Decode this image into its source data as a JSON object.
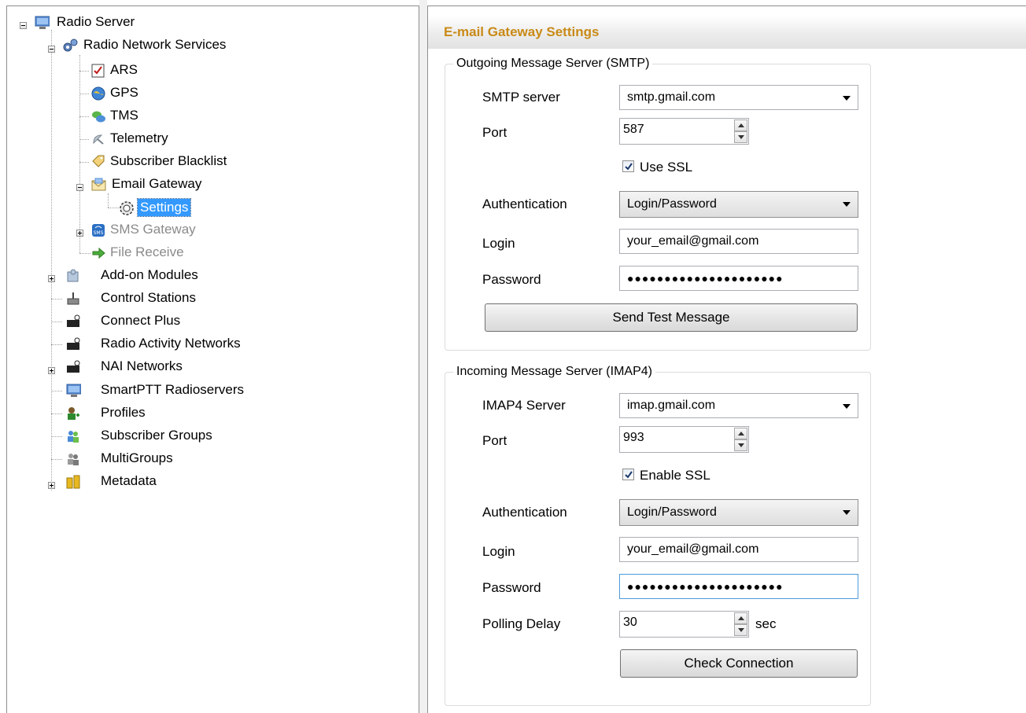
{
  "tree": {
    "root": "Radio Server",
    "radio_network_services": "Radio Network Services",
    "ars": "ARS",
    "gps": "GPS",
    "tms": "TMS",
    "telemetry": "Telemetry",
    "subscriber_blacklist": "Subscriber Blacklist",
    "email_gateway": "Email Gateway",
    "settings": "Settings",
    "sms_gateway": "SMS Gateway",
    "file_receive": "File Receive",
    "addon_modules": "Add-on Modules",
    "control_stations": "Control Stations",
    "connect_plus": "Connect Plus",
    "radio_activity_networks": "Radio Activity Networks",
    "nai_networks": "NAI Networks",
    "smartptt_radioservers": "SmartPTT Radioservers",
    "profiles": "Profiles",
    "subscriber_groups": "Subscriber Groups",
    "multigroups": "MultiGroups",
    "metadata": "Metadata"
  },
  "settings": {
    "title": "E-mail Gateway Settings",
    "smtp": {
      "group_title": "Outgoing Message Server (SMTP)",
      "server_label": "SMTP server",
      "server_value": "smtp.gmail.com",
      "port_label": "Port",
      "port_value": "587",
      "ssl_label": "Use SSL",
      "ssl_checked": true,
      "auth_label": "Authentication",
      "auth_value": "Login/Password",
      "login_label": "Login",
      "login_value": "your_email@gmail.com",
      "password_label": "Password",
      "password_value": "●●●●●●●●●●●●●●●●●●●●●",
      "test_button": "Send Test Message"
    },
    "imap": {
      "group_title": "Incoming Message Server (IMAP4)",
      "server_label": "IMAP4 Server",
      "server_value": "imap.gmail.com",
      "port_label": "Port",
      "port_value": "993",
      "ssl_label": "Enable SSL",
      "ssl_checked": true,
      "auth_label": "Authentication",
      "auth_value": "Login/Password",
      "login_label": "Login",
      "login_value": "your_email@gmail.com",
      "password_label": "Password",
      "password_value": "●●●●●●●●●●●●●●●●●●●●●",
      "polling_label": "Polling Delay",
      "polling_value": "30",
      "polling_unit": "sec",
      "check_button": "Check Connection"
    }
  },
  "colors": {
    "title": "#c98a17",
    "selection": "#3399ff"
  }
}
